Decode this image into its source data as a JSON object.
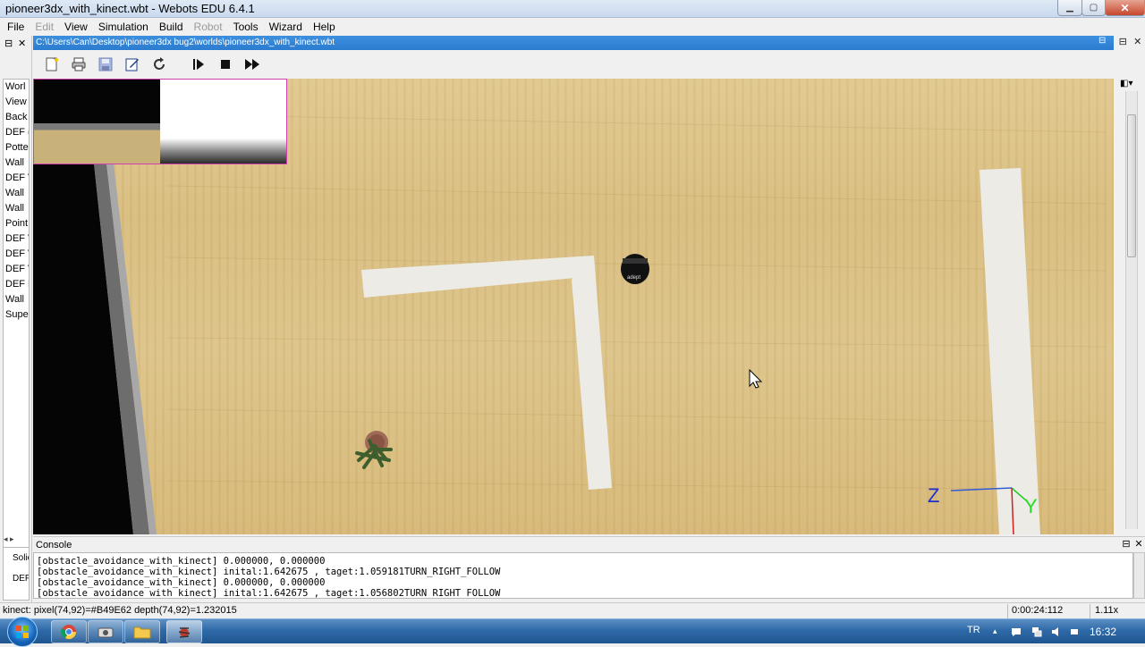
{
  "window": {
    "title": "pioneer3dx_with_kinect.wbt - Webots EDU 6.4.1"
  },
  "menu": [
    "File",
    "Edit",
    "View",
    "Simulation",
    "Build",
    "Robot",
    "Tools",
    "Wizard",
    "Help"
  ],
  "view": {
    "path": "C:\\Users\\Can\\Desktop\\pioneer3dx bug2\\worlds\\pioneer3dx_with_kinect.wbt"
  },
  "scene_tree": [
    "Worl",
    "View",
    "Back",
    "DEF (",
    "Potte",
    "Wall",
    "DEF V",
    "Wall",
    "Wall",
    "Point",
    "DEF V",
    "DEF V",
    "DEF V",
    "DEF F",
    "Wall",
    "Supe"
  ],
  "field_box": [
    "Solic",
    "DEF"
  ],
  "axes": {
    "z": "Z",
    "y": "Y"
  },
  "console": {
    "title": "Console",
    "lines": [
      "[obstacle_avoidance_with_kinect] 0.000000, 0.000000",
      "[obstacle_avoidance_with_kinect] inital:1.642675 , taget:1.059181TURN_RIGHT_FOLLOW",
      "[obstacle_avoidance_with_kinect] 0.000000, 0.000000",
      "[obstacle_avoidance_with_kinect] inital:1.642675 , taget:1.056802TURN_RIGHT_FOLLOW"
    ]
  },
  "status": {
    "message": "kinect: pixel(74,92)=#B49E62 depth(74,92)=1.232015",
    "time": "0:00:24:112",
    "speed": "1.11x"
  },
  "taskbar": {
    "lang": "TR",
    "clock": "16:32"
  },
  "robot_label": "adept"
}
